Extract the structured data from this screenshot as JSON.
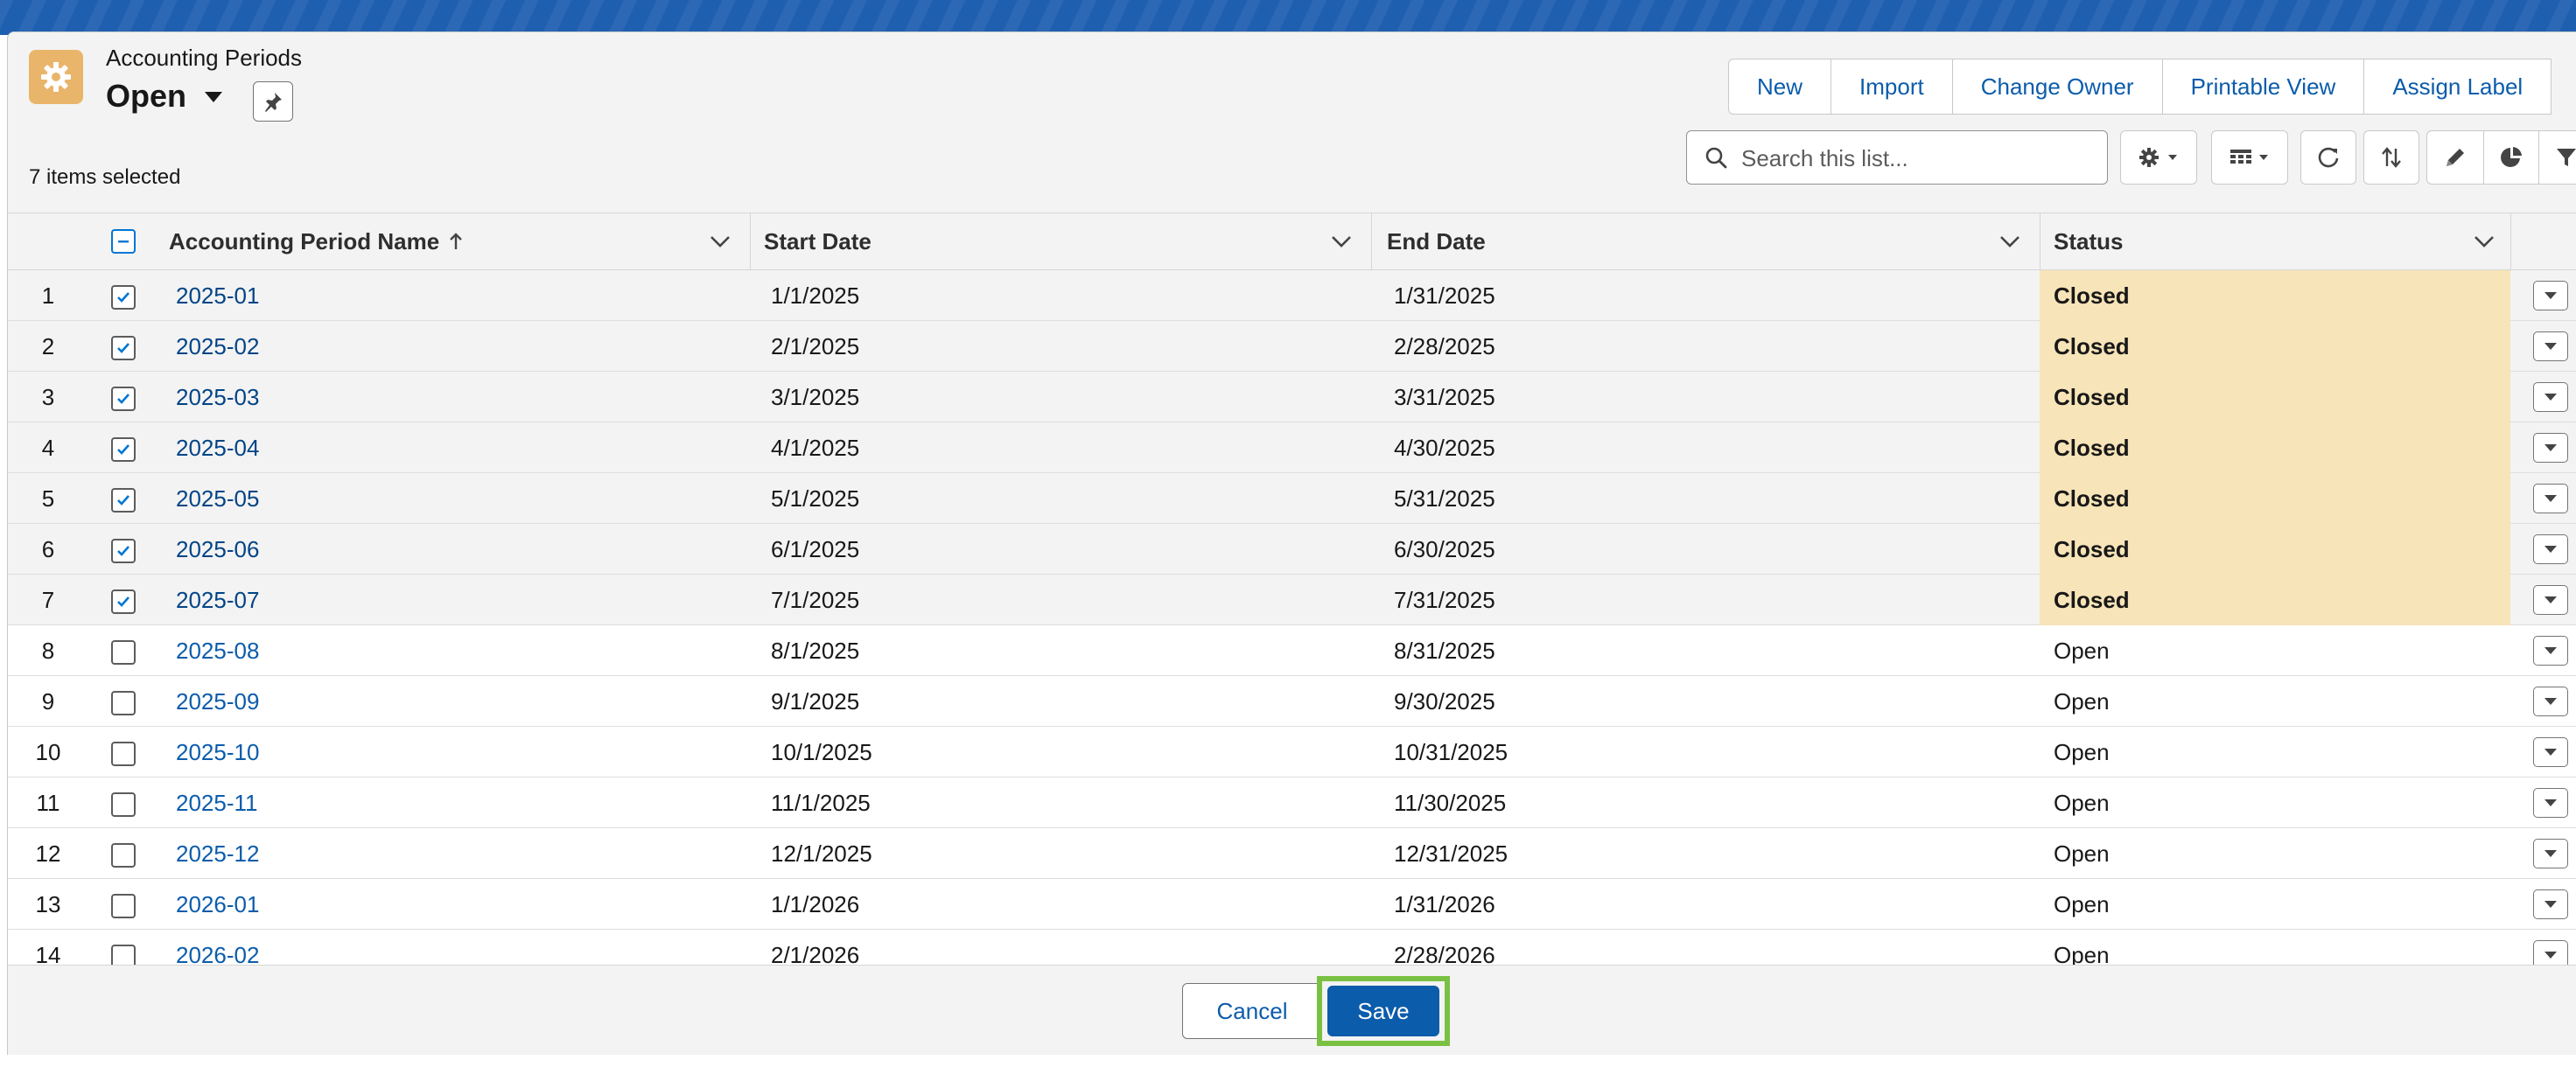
{
  "header": {
    "object_label": "Accounting Periods",
    "list_view_name": "Open",
    "selected_count": "7 items selected"
  },
  "actions": [
    {
      "label": "New"
    },
    {
      "label": "Import"
    },
    {
      "label": "Change Owner"
    },
    {
      "label": "Printable View"
    },
    {
      "label": "Assign Label"
    }
  ],
  "search": {
    "placeholder": "Search this list...",
    "value": ""
  },
  "table": {
    "columns": [
      {
        "label": "Accounting Period Name",
        "sort": "ascending"
      },
      {
        "label": "Start Date"
      },
      {
        "label": "End Date"
      },
      {
        "label": "Status"
      }
    ],
    "rows": [
      {
        "num": "1",
        "selected": true,
        "name": "2025-01",
        "start": "1/1/2025",
        "end": "1/31/2025",
        "status": "Closed"
      },
      {
        "num": "2",
        "selected": true,
        "name": "2025-02",
        "start": "2/1/2025",
        "end": "2/28/2025",
        "status": "Closed"
      },
      {
        "num": "3",
        "selected": true,
        "name": "2025-03",
        "start": "3/1/2025",
        "end": "3/31/2025",
        "status": "Closed"
      },
      {
        "num": "4",
        "selected": true,
        "name": "2025-04",
        "start": "4/1/2025",
        "end": "4/30/2025",
        "status": "Closed"
      },
      {
        "num": "5",
        "selected": true,
        "name": "2025-05",
        "start": "5/1/2025",
        "end": "5/31/2025",
        "status": "Closed"
      },
      {
        "num": "6",
        "selected": true,
        "name": "2025-06",
        "start": "6/1/2025",
        "end": "6/30/2025",
        "status": "Closed"
      },
      {
        "num": "7",
        "selected": true,
        "name": "2025-07",
        "start": "7/1/2025",
        "end": "7/31/2025",
        "status": "Closed"
      },
      {
        "num": "8",
        "selected": false,
        "name": "2025-08",
        "start": "8/1/2025",
        "end": "8/31/2025",
        "status": "Open"
      },
      {
        "num": "9",
        "selected": false,
        "name": "2025-09",
        "start": "9/1/2025",
        "end": "9/30/2025",
        "status": "Open"
      },
      {
        "num": "10",
        "selected": false,
        "name": "2025-10",
        "start": "10/1/2025",
        "end": "10/31/2025",
        "status": "Open"
      },
      {
        "num": "11",
        "selected": false,
        "name": "2025-11",
        "start": "11/1/2025",
        "end": "11/30/2025",
        "status": "Open"
      },
      {
        "num": "12",
        "selected": false,
        "name": "2025-12",
        "start": "12/1/2025",
        "end": "12/31/2025",
        "status": "Open"
      },
      {
        "num": "13",
        "selected": false,
        "name": "2026-01",
        "start": "1/1/2026",
        "end": "1/31/2026",
        "status": "Open"
      },
      {
        "num": "14",
        "selected": false,
        "name": "2026-02",
        "start": "2/1/2026",
        "end": "2/28/2026",
        "status": "Open"
      }
    ]
  },
  "footer": {
    "cancel_label": "Cancel",
    "save_label": "Save"
  },
  "colors": {
    "brand_blue": "#0b5cab",
    "app_icon": "#e9b56a",
    "edited_cell": "#f7e4b8",
    "highlight_border": "#7ac143"
  },
  "icons": [
    "gear-icon",
    "caret-down-icon",
    "pin-icon",
    "search-icon",
    "settings-icon",
    "table-view-icon",
    "refresh-icon",
    "sort-icon",
    "pencil-icon",
    "chart-icon",
    "filter-icon",
    "checkbox-icon",
    "chevron-down-icon"
  ]
}
